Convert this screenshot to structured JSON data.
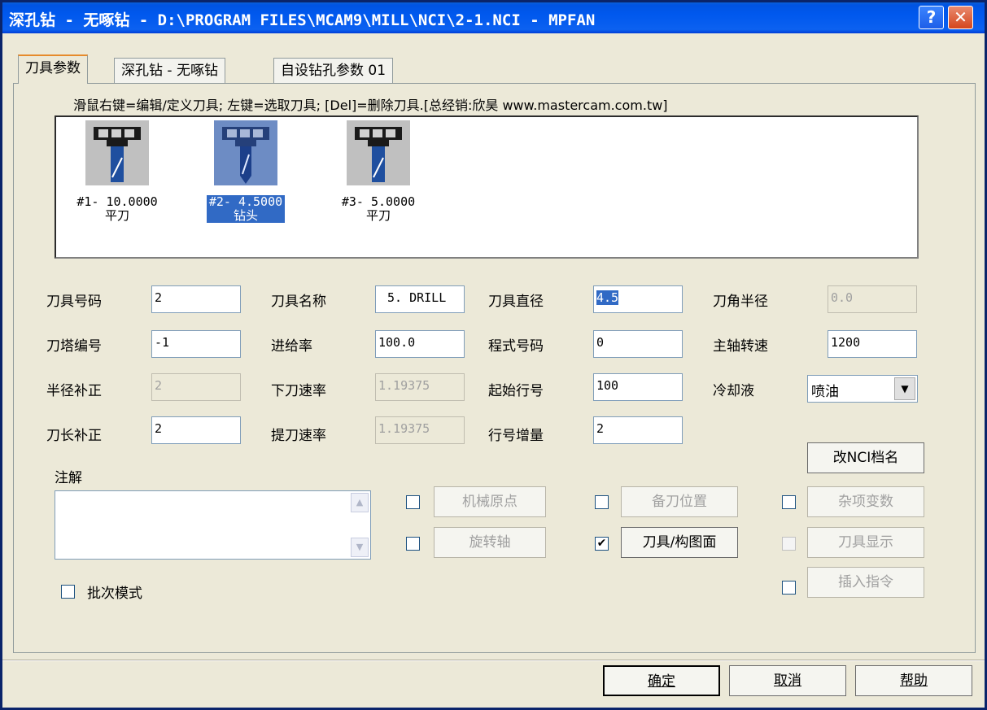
{
  "window": {
    "title": "深孔钻 - 无啄钻 - D:\\PROGRAM FILES\\MCAM9\\MILL\\NCI\\2-1.NCI - MPFAN",
    "help_label": "?",
    "close_label": "✕"
  },
  "tabs": [
    "刀具参数",
    "深孔钻 - 无啄钻",
    "自设钻孔参数 01"
  ],
  "hint": "滑鼠右键=编辑/定义刀具; 左键=选取刀具; [Del]=删除刀具.[总经销:欣昊 www.mastercam.com.tw]",
  "tools": [
    {
      "line1": "#1- 10.0000",
      "line2": "平刀"
    },
    {
      "line1": "#2- 4.5000",
      "line2": "钻头"
    },
    {
      "line1": "#3- 5.0000",
      "line2": "平刀"
    }
  ],
  "fields": {
    "tool_number": {
      "label": "刀具号码",
      "value": "2"
    },
    "tool_name": {
      "label": "刀具名称",
      "value": "5. DRILL"
    },
    "tool_diameter": {
      "label": "刀具直径",
      "value": "4.5"
    },
    "corner_radius": {
      "label": "刀角半径",
      "value": "0.0"
    },
    "turret_number": {
      "label": "刀塔编号",
      "value": "-1"
    },
    "feed_rate": {
      "label": "进给率",
      "value": "100.0"
    },
    "program_number": {
      "label": "程式号码",
      "value": "0"
    },
    "spindle_speed": {
      "label": "主轴转速",
      "value": "1200"
    },
    "radius_comp": {
      "label": "半径补正",
      "value": "2"
    },
    "plunge_rate": {
      "label": "下刀速率",
      "value": "1.19375"
    },
    "start_line": {
      "label": "起始行号",
      "value": "100"
    },
    "coolant": {
      "label": "冷却液",
      "value": "喷油"
    },
    "length_comp": {
      "label": "刀长补正",
      "value": "2"
    },
    "retract_rate": {
      "label": "提刀速率",
      "value": "1.19375"
    },
    "line_increment": {
      "label": "行号增量",
      "value": "2"
    }
  },
  "comment_label": "注解",
  "options": {
    "machine_home": "机械原点",
    "standby_position": "备刀位置",
    "misc_values": "杂项变数",
    "rotary_axis": "旋转轴",
    "tool_plane": "刀具/构图面",
    "tool_display": "刀具显示",
    "insert_command": "插入指令",
    "batch_mode": "批次模式",
    "rename_nci": "改NCI档名",
    "tool_plane_checkmark": "✔"
  },
  "footer": {
    "ok": "确定",
    "cancel": "取消",
    "help": "帮助"
  }
}
